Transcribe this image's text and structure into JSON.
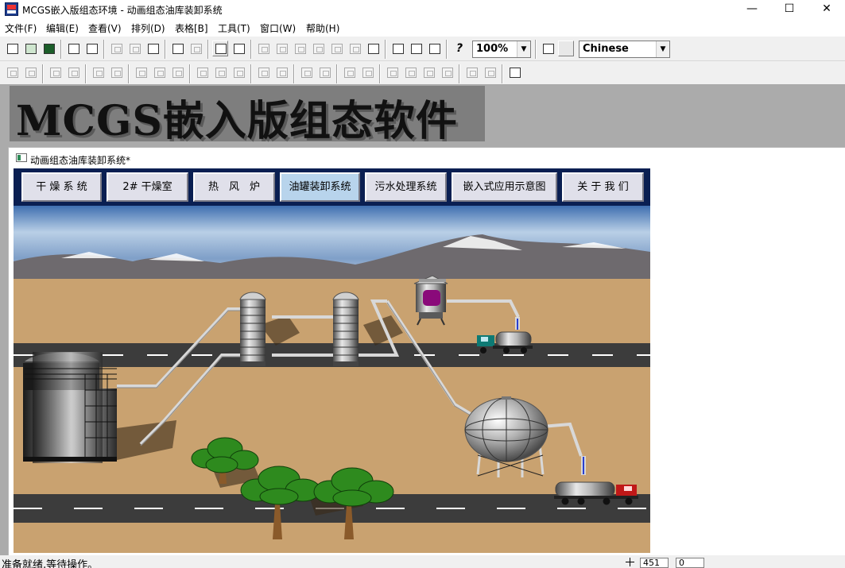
{
  "window": {
    "title": "MCGS嵌入版组态环境 - 动画组态油库装卸系统",
    "minimize": "—",
    "maximize": "☐",
    "close": "✕"
  },
  "menu": [
    {
      "label": "文件(F)"
    },
    {
      "label": "编辑(E)"
    },
    {
      "label": "查看(V)"
    },
    {
      "label": "排列(D)"
    },
    {
      "label": "表格[B]"
    },
    {
      "label": "工具(T)"
    },
    {
      "label": "窗口(W)"
    },
    {
      "label": "帮助(H)"
    }
  ],
  "toolbar": {
    "zoom": "100%",
    "help_glyph": "?",
    "language": "Chinese"
  },
  "banner": {
    "text": "MCGS嵌入版组态软件"
  },
  "document": {
    "title": "动画组态油库装卸系统*"
  },
  "nav": [
    {
      "label": "干 燥 系 统"
    },
    {
      "label": "2# 干燥室"
    },
    {
      "label": "热　风　炉"
    },
    {
      "label": "油罐装卸系统",
      "active": true
    },
    {
      "label": "污水处理系统"
    },
    {
      "label": "嵌入式应用示意图"
    },
    {
      "label": "关 于 我 们"
    }
  ],
  "status": {
    "text": "准备就绪,等待操作。",
    "x": "451",
    "y": "0"
  },
  "colors": {
    "nav_bg": "#0a1f52",
    "ground": "#c9a270",
    "road": "#3c3c3c",
    "active_button": "#b8d4ec",
    "tank_liquid": "#8a0a7a"
  }
}
